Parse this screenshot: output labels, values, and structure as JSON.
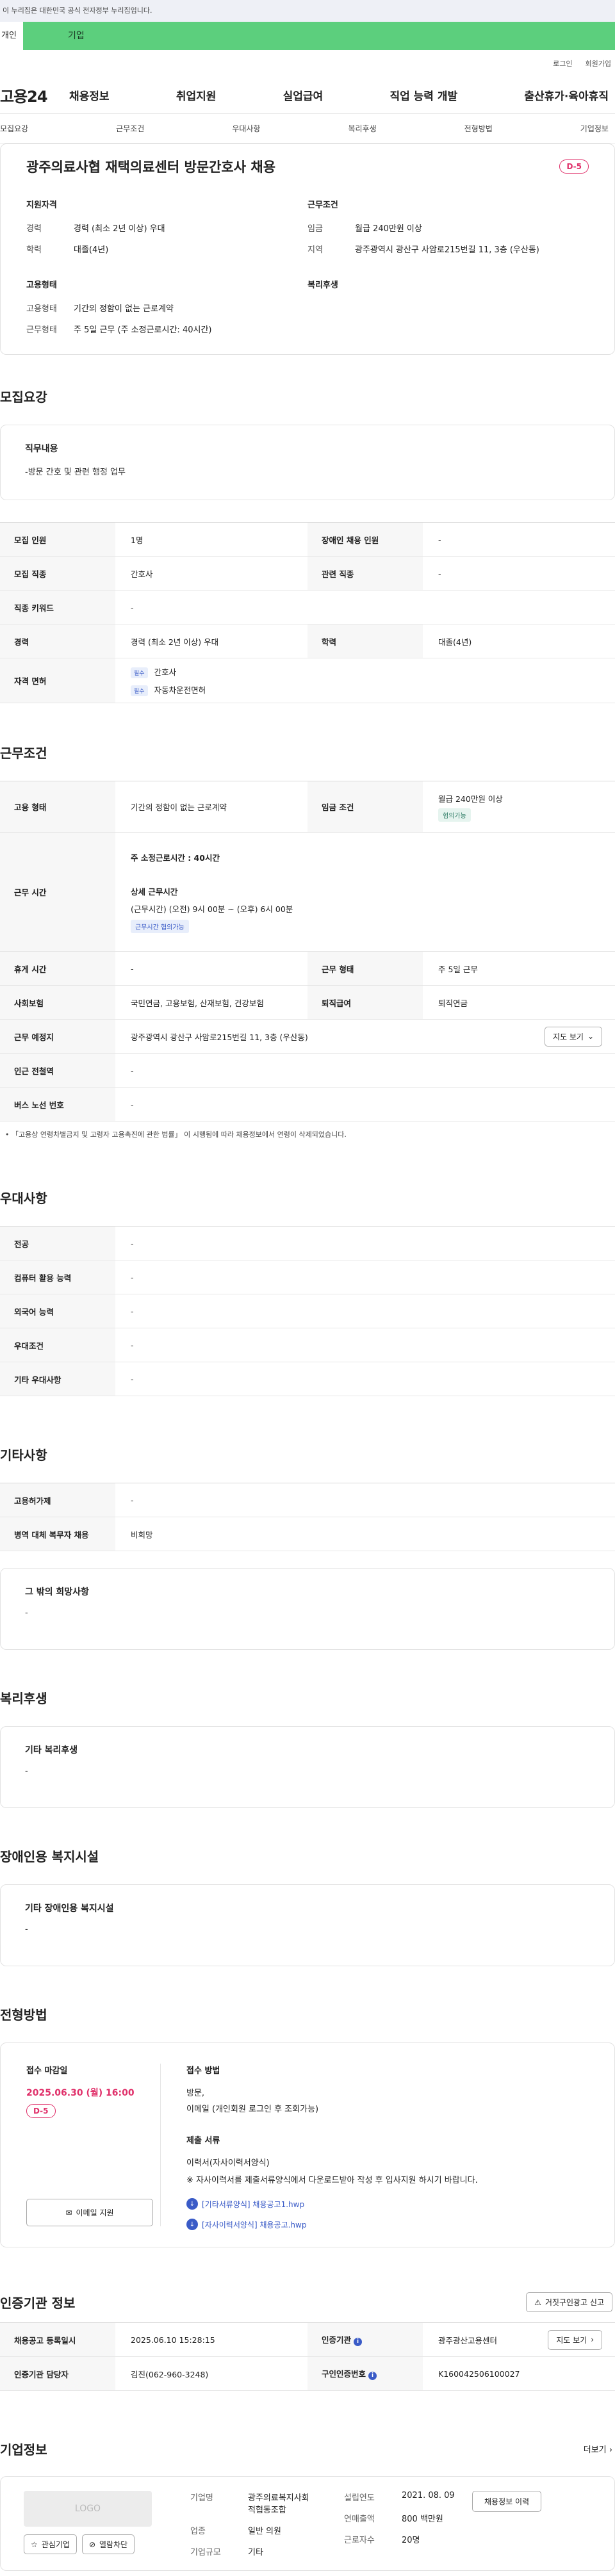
{
  "gov_banner": "이 누리집은 대한민국 공식 전자정부 누리집입니다.",
  "top_tabs": {
    "personal": "개인",
    "company": "기업"
  },
  "util": {
    "login": "로그인",
    "signup": "회원가입"
  },
  "gnb": {
    "logo": "고용24",
    "menu": [
      "채용정보",
      "취업지원",
      "실업급여",
      "직업 능력 개발",
      "출산휴가·육아휴직"
    ]
  },
  "subnav": [
    "모집요강",
    "근무조건",
    "우대사항",
    "복리후생",
    "전형방법",
    "기업정보"
  ],
  "summary": {
    "title": "광주의료사협 재택의료센터 방문간호사 채용",
    "dday": "D-5",
    "qual_title": "지원자격",
    "qual": [
      {
        "k": "경력",
        "v": "경력 (최소 2년 이상) 우대"
      },
      {
        "k": "학력",
        "v": "대졸(4년)"
      }
    ],
    "cond_title": "근무조건",
    "cond": [
      {
        "k": "임금",
        "v": "월급 240만원 이상"
      },
      {
        "k": "지역",
        "v": "광주광역시 광산구 사암로215번길 11, 3층 (우산동)"
      }
    ],
    "emp_title": "고용형태",
    "emp": [
      {
        "k": "고용형태",
        "v": "기간의 정함이 없는 근로계약"
      },
      {
        "k": "근무형태",
        "v": "주 5일 근무 (주 소정근로시간: 40시간)"
      }
    ],
    "welfare_title": "복리후생"
  },
  "recruit": {
    "section": "모집요강",
    "duty_title": "직무내용",
    "duty_text": "-방문 간호 및 관련 행정 업무",
    "rows": {
      "count_k": "모집 인원",
      "count_v": "1명",
      "disabled_k": "장애인 채용 인원",
      "disabled_v": "-",
      "job_k": "모집 직종",
      "job_v": "간호사",
      "related_k": "관련 직종",
      "related_v": "-",
      "keyword_k": "직종 키워드",
      "keyword_v": "-",
      "career_k": "경력",
      "career_v": "경력 (최소 2년 이상) 우대",
      "edu_k": "학력",
      "edu_v": "대졸(4년)",
      "license_k": "자격 면허",
      "license": [
        {
          "tag": "필수",
          "name": "간호사"
        },
        {
          "tag": "필수",
          "name": "자동차운전면허"
        }
      ]
    }
  },
  "work": {
    "section": "근무조건",
    "emp_k": "고용 형태",
    "emp_v": "기간의 정함이 없는 근로계약",
    "wage_k": "임금 조건",
    "wage_v": "월급 240만원 이상",
    "wage_tag": "협의가능",
    "hours_k": "근무 시간",
    "hours_weekly": "주 소정근로시간 : 40시간",
    "hours_detail_title": "상세 근무시간",
    "hours_detail": "(근무시간) (오전) 9시 00분 ~ (오후) 6시 00분",
    "hours_tag": "근무시간 협의가능",
    "break_k": "휴게 시간",
    "break_v": "-",
    "type_k": "근무 형태",
    "type_v": "주 5일 근무",
    "insurance_k": "사회보험",
    "insurance_v": "국민연금, 고용보험, 산재보험, 건강보험",
    "severance_k": "퇴직급여",
    "severance_v": "퇴직연금",
    "place_k": "근무 예정지",
    "place_v": "광주광역시 광산구 사암로215번길 11, 3층 (우산동)",
    "map_btn": "지도 보기",
    "subway_k": "인근 전철역",
    "subway_v": "-",
    "bus_k": "버스 노선 번호",
    "bus_v": "-",
    "note": "「고용상 연령차별금지 및 고령자 고용촉진에 관한 법률」 이 시행됨에 따라 채용정보에서 연령이 삭제되었습니다."
  },
  "prefer": {
    "section": "우대사항",
    "rows": [
      {
        "k": "전공",
        "v": "-"
      },
      {
        "k": "컴퓨터 활용 능력",
        "v": "-"
      },
      {
        "k": "외국어 능력",
        "v": "-"
      },
      {
        "k": "우대조건",
        "v": "-"
      },
      {
        "k": "기타 우대사항",
        "v": "-"
      }
    ]
  },
  "etc": {
    "section": "기타사항",
    "rows": [
      {
        "k": "고용허가제",
        "v": "-"
      },
      {
        "k": "병역 대체 복무자 채용",
        "v": "비희망"
      }
    ],
    "other_title": "그 밖의 희망사항",
    "other_v": "-"
  },
  "welfare": {
    "section": "복리후생",
    "title": "기타 복리후생",
    "v": "-"
  },
  "facility": {
    "section": "장애인용 복지시설",
    "title": "기타 장애인용 복지시설",
    "v": "-"
  },
  "process": {
    "section": "전형방법",
    "deadline_title": "접수 마감일",
    "deadline": "2025.06.30 (월) 16:00",
    "dday": "D-5",
    "email_btn": "이메일 지원",
    "method_title": "접수 방법",
    "method": [
      "방문,",
      "이메일 (개인회원 로그인 후 조회가능)"
    ],
    "docs_title": "제출 서류",
    "docs": [
      "이력서(자사이력서양식)",
      "※ 자사이력서를 제출서류양식에서 다운로드받아 작성 후 입사지원 하시기 바랍니다."
    ],
    "files": [
      "[기타서류양식] 채용공고1.hwp",
      "[자사이력서양식] 채용공고.hwp"
    ]
  },
  "agency": {
    "section": "인증기관 정보",
    "report_btn": "거짓구인광고 신고",
    "reg_k": "채용공고 등록일시",
    "reg_v": "2025.06.10 15:28:15",
    "agency_k": "인증기관",
    "agency_v": "광주광산고용센터",
    "map_btn": "지도 보기",
    "manager_k": "인증기관 담당자",
    "manager_v": "김진(062-960-3248)",
    "no_k": "구인인증번호",
    "no_v": "K160042506100027"
  },
  "company": {
    "section": "기업정보",
    "more": "더보기",
    "logo_text": "LOGO",
    "fav_btn": "관심기업",
    "block_btn": "열람차단",
    "name_k": "기업명",
    "name_v": [
      "광주의료복지사회",
      "적협동조합"
    ],
    "industry_k": "업종",
    "industry_v": "일반 의원",
    "size_k": "기업규모",
    "size_v": "기타",
    "founded_k": "설립연도",
    "founded_v": "2021. 08. 09",
    "sales_k": "연매출액",
    "sales_v": "800 백만원",
    "staff_k": "근로자수",
    "staff_v": "20명",
    "history_btn": "채용정보 이력"
  }
}
